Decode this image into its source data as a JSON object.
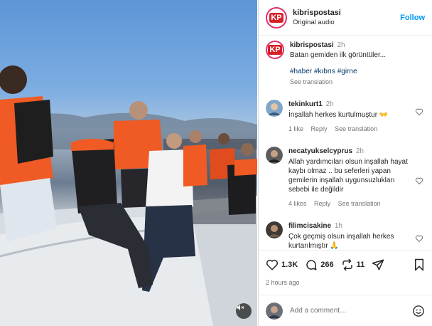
{
  "header": {
    "username": "kibrispostasi",
    "subtitle": "Original audio",
    "follow_label": "Follow",
    "avatar_letters": "KP"
  },
  "caption": {
    "username": "kibrispostasi",
    "time": "2h",
    "text": "Batan gemiden ilk görüntüler...",
    "hashtags": "#haber #kıbrıs #girne",
    "see_translation": "See translation"
  },
  "comments": [
    {
      "username": "tekinkurt1",
      "time": "2h",
      "text": "İnşallah herkes kurtulmuştur 👐",
      "likes": "1 like",
      "reply": "Reply",
      "see_translation": "See translation"
    },
    {
      "username": "necatyukselcyprus",
      "time": "2h",
      "text": "Allah yardımcıları olsun inşallah hayat kaybı olmaz .. bu seferleri yapan gemilerin inşallah uygunsuzlukları sebebi ile değildir",
      "likes": "4 likes",
      "reply": "Reply",
      "see_translation": "See translation"
    },
    {
      "username": "filimcisakine",
      "time": "1h",
      "text": "Çok geçmiş olsun inşallah herkes kurtarılmıştır 🙏"
    }
  ],
  "actions": {
    "likes": "1.3K",
    "comments": "266",
    "reposts": "11",
    "posted": "2 hours ago"
  },
  "add_comment": {
    "placeholder": "Add a comment…"
  },
  "colors": {
    "accent": "#0095f6",
    "brand_red": "#d62027",
    "link": "#00376b",
    "life_jacket": "#f05a24"
  },
  "icons": [
    "heart-icon",
    "comment-icon",
    "repost-icon",
    "share-icon",
    "bookmark-icon",
    "emoji-icon",
    "mute-icon"
  ]
}
